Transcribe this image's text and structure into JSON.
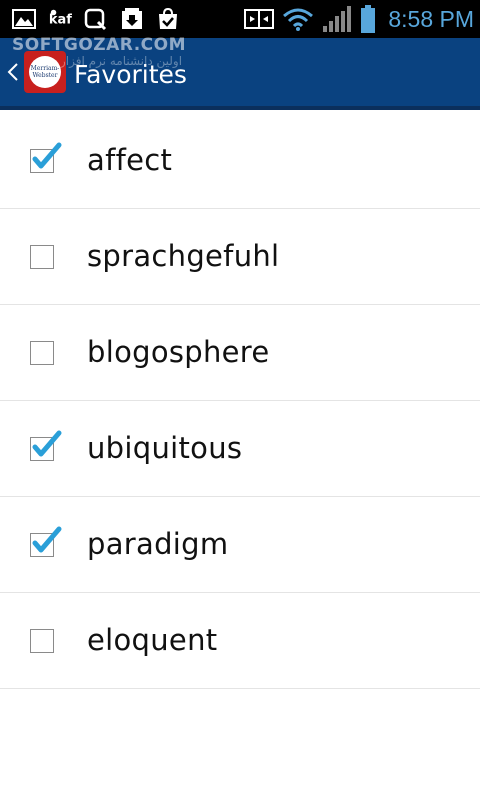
{
  "status_bar": {
    "time": "8:58 PM",
    "icons_left": [
      "gallery-icon",
      "media-player-icon",
      "search-app-icon",
      "downloads-icon",
      "store-check-icon"
    ],
    "icons_right": [
      "screen-share-icon",
      "wifi-icon",
      "signal-icon",
      "battery-icon"
    ],
    "time_color": "#58a7dc"
  },
  "action_bar": {
    "title": "Favorites",
    "logo_text_line1": "Merriam-",
    "logo_text_line2": "Webster",
    "background_color": "#0a4280"
  },
  "watermark": {
    "text": "SOFTGOZAR.COM",
    "subtext": "اولین دانشنامه نرم افزار"
  },
  "favorites": [
    {
      "word": "affect",
      "checked": true
    },
    {
      "word": "sprachgefuhl",
      "checked": false
    },
    {
      "word": "blogosphere",
      "checked": false
    },
    {
      "word": "ubiquitous",
      "checked": true
    },
    {
      "word": "paradigm",
      "checked": true
    },
    {
      "word": "eloquent",
      "checked": false
    }
  ],
  "colors": {
    "check_mark": "#2a9fd8",
    "divider": "#e4e4e4"
  }
}
